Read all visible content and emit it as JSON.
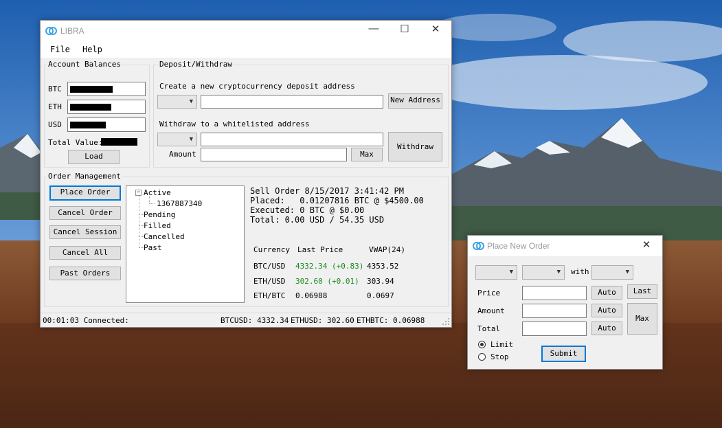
{
  "main_window": {
    "title": "LIBRA",
    "menu": [
      "File",
      "Help"
    ],
    "account_balances": {
      "heading": "Account Balances",
      "btc_label": "BTC",
      "eth_label": "ETH",
      "usd_label": "USD",
      "total_label": "Total Value:",
      "load_label": "Load"
    },
    "deposit_withdraw": {
      "heading": "Deposit/Withdraw",
      "deposit_caption": "Create a new cryptocurrency deposit address",
      "new_address_label": "New Address",
      "withdraw_caption": "Withdraw to a whitelisted address",
      "amount_label": "Amount",
      "max_label": "Max",
      "withdraw_label": "Withdraw"
    },
    "order_management": {
      "heading": "Order Management",
      "buttons": [
        "Place Order",
        "Cancel Order",
        "Cancel Session",
        "Cancel All",
        "Past Orders"
      ],
      "tree": {
        "root": "Active",
        "child": "1367887340",
        "siblings": [
          "Pending",
          "Filled",
          "Cancelled",
          "Past"
        ]
      },
      "detail": {
        "line1": "Sell Order 8/15/2017 3:41:42 PM",
        "line2": "Placed:   0.01207816 BTC @ $4500.00",
        "line3": "Executed: 0 BTC @ $0.00",
        "line4": "Total: 0.00 USD / 54.35 USD"
      },
      "price_table": {
        "headers": [
          "Currency",
          "Last Price",
          "VWAP(24)"
        ],
        "rows": [
          {
            "currency": "BTC/USD",
            "last": "4332.34 (+0.83)",
            "vwap": "4353.52"
          },
          {
            "currency": "ETH/USD",
            "last": "302.60 (+0.01)",
            "vwap": "303.94"
          },
          {
            "currency": "ETH/BTC",
            "last": "0.06988",
            "vwap": "0.0697"
          }
        ]
      }
    },
    "status": {
      "left": "00:01:03 Connected:",
      "btcusd": "BTCUSD: 4332.34",
      "ethusd": "ETHUSD: 302.60",
      "ethbtc": "ETHBTC: 0.06988"
    }
  },
  "order_window": {
    "title": "Place New Order",
    "with_label": "with",
    "price_label": "Price",
    "amount_label": "Amount",
    "total_label": "Total",
    "auto_label": "Auto",
    "last_label": "Last",
    "max_label": "Max",
    "limit_label": "Limit",
    "stop_label": "Stop",
    "submit_label": "Submit",
    "selected_order_type": "Limit"
  },
  "colors": {
    "accent": "#0078d7",
    "positive": "#1a8a1a",
    "logo": "#3aa3e3"
  }
}
